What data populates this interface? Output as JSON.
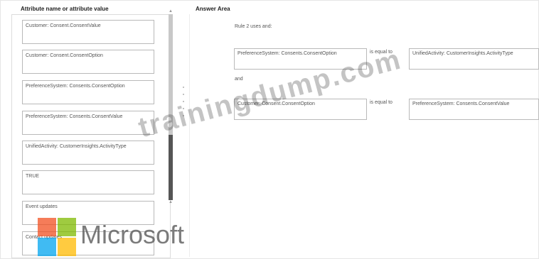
{
  "source_panel": {
    "header": "Attribute name or attribute value",
    "items": [
      "Customer: Consent.ConsentValue",
      "Customer: Consent.ConsentOption",
      "PreferenceSystem: Consents.ConsentOption",
      "PreferenceSystem: Consents.ConsentValue",
      "UnifiedActivity: CustomerInsights.ActivityType",
      "TRUE",
      "Event updates",
      "Contact updates"
    ]
  },
  "answer_area": {
    "header": "Answer Area",
    "rule_text": "Rule 2 uses and:",
    "row1": {
      "left": "PreferenceSystem: Consents.ConsentOption",
      "operator": "is equal to",
      "right": "UnifiedActivity: CustomerInsights.ActivityType"
    },
    "and_text": "and",
    "row2": {
      "left": "Customer: Consent.ConsentOption",
      "operator": "is equal to",
      "right": "PreferenceSystem: Consents.ConsentValue"
    }
  },
  "watermark": "trainingdump.com",
  "logo": {
    "text": "Microsoft",
    "colors": [
      "#f25022",
      "#7fba00",
      "#00a4ef",
      "#ffb900"
    ]
  }
}
